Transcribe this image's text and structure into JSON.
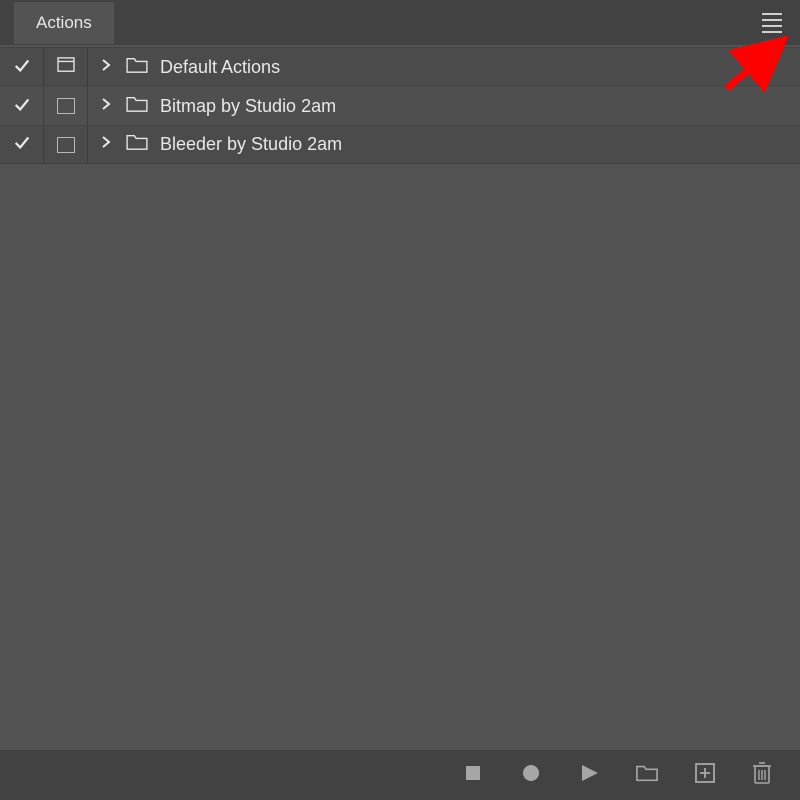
{
  "panel": {
    "title": "Actions"
  },
  "actions": [
    {
      "label": "Default Actions",
      "dialog_filled": true
    },
    {
      "label": "Bitmap by Studio 2am",
      "dialog_filled": false
    },
    {
      "label": "Bleeder by Studio 2am",
      "dialog_filled": false
    }
  ],
  "footer": {
    "stop": "Stop",
    "record": "Record",
    "play": "Play",
    "new_set": "New Set",
    "new_action": "New Action",
    "delete": "Delete"
  }
}
